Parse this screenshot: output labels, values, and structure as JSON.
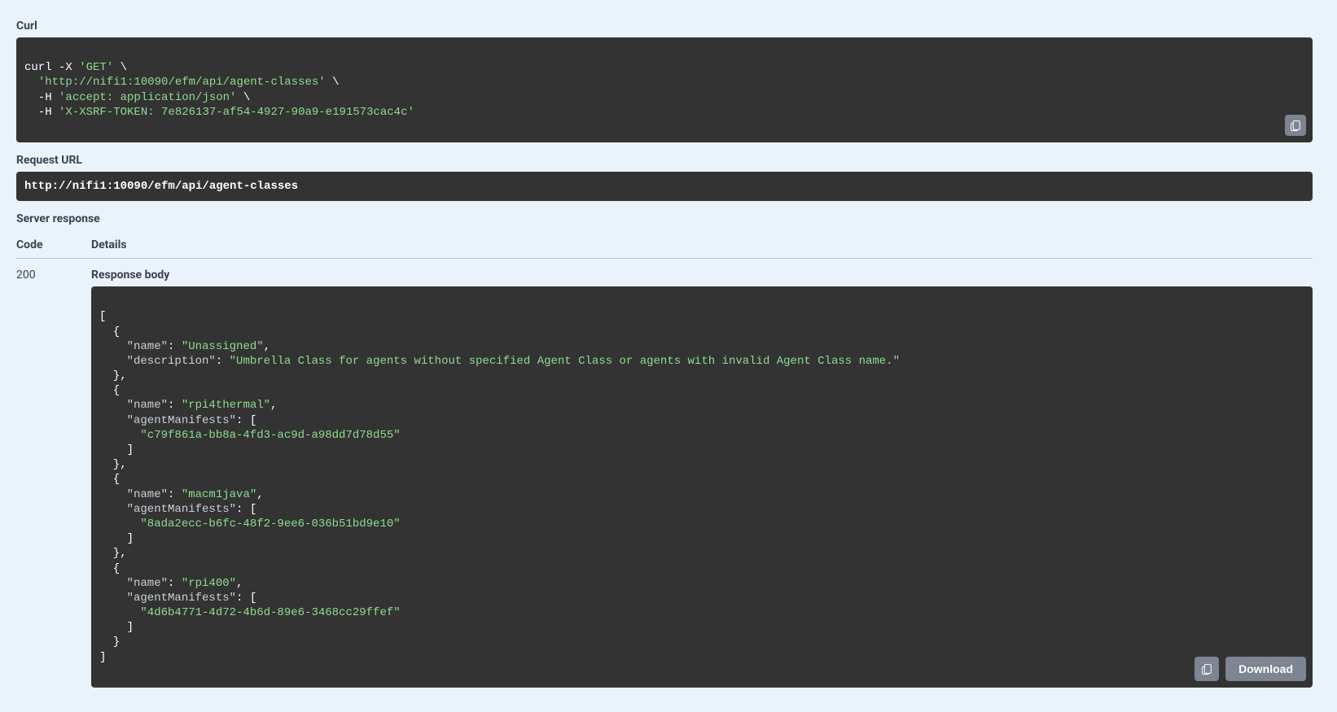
{
  "labels": {
    "curl": "Curl",
    "request_url": "Request URL",
    "server_response": "Server response",
    "code_col": "Code",
    "details_col": "Details",
    "response_body": "Response body",
    "download": "Download"
  },
  "curl": {
    "p0a": "curl -X ",
    "p0b": "'GET'",
    "p0c": " \\",
    "p1a": "  ",
    "p1b": "'http://nifi1:10090/efm/api/agent-classes'",
    "p1c": " \\",
    "p2a": "  -H ",
    "p2b": "'accept: application/json'",
    "p2c": " \\",
    "p3a": "  -H ",
    "p3b": "'X-XSRF-TOKEN: 7e826137-af54-4927-90a9-e191573cac4c'"
  },
  "request_url": "http://nifi1:10090/efm/api/agent-classes",
  "response": {
    "code": "200",
    "body_lines": {
      "l0": "[",
      "l1": "  {",
      "l2a": "    \"name\"",
      "l2b": ": ",
      "l2c": "\"Unassigned\"",
      "l2d": ",",
      "l3a": "    \"description\"",
      "l3b": ": ",
      "l3c": "\"Umbrella Class for agents without specified Agent Class or agents with invalid Agent Class name.\"",
      "l4": "  },",
      "l5": "  {",
      "l6a": "    \"name\"",
      "l6b": ": ",
      "l6c": "\"rpi4thermal\"",
      "l6d": ",",
      "l7a": "    \"agentManifests\"",
      "l7b": ": [",
      "l8": "      \"c79f861a-bb8a-4fd3-ac9d-a98dd7d78d55\"",
      "l9": "    ]",
      "l10": "  },",
      "l11": "  {",
      "l12a": "    \"name\"",
      "l12b": ": ",
      "l12c": "\"macm1java\"",
      "l12d": ",",
      "l13a": "    \"agentManifests\"",
      "l13b": ": [",
      "l14": "      \"8ada2ecc-b6fc-48f2-9ee6-036b51bd9e10\"",
      "l15": "    ]",
      "l16": "  },",
      "l17": "  {",
      "l18a": "    \"name\"",
      "l18b": ": ",
      "l18c": "\"rpi400\"",
      "l18d": ",",
      "l19a": "    \"agentManifests\"",
      "l19b": ": [",
      "l20": "      \"4d6b4771-4d72-4b6d-89e6-3468cc29ffef\"",
      "l21": "    ]",
      "l22": "  }",
      "l23": "]"
    }
  }
}
